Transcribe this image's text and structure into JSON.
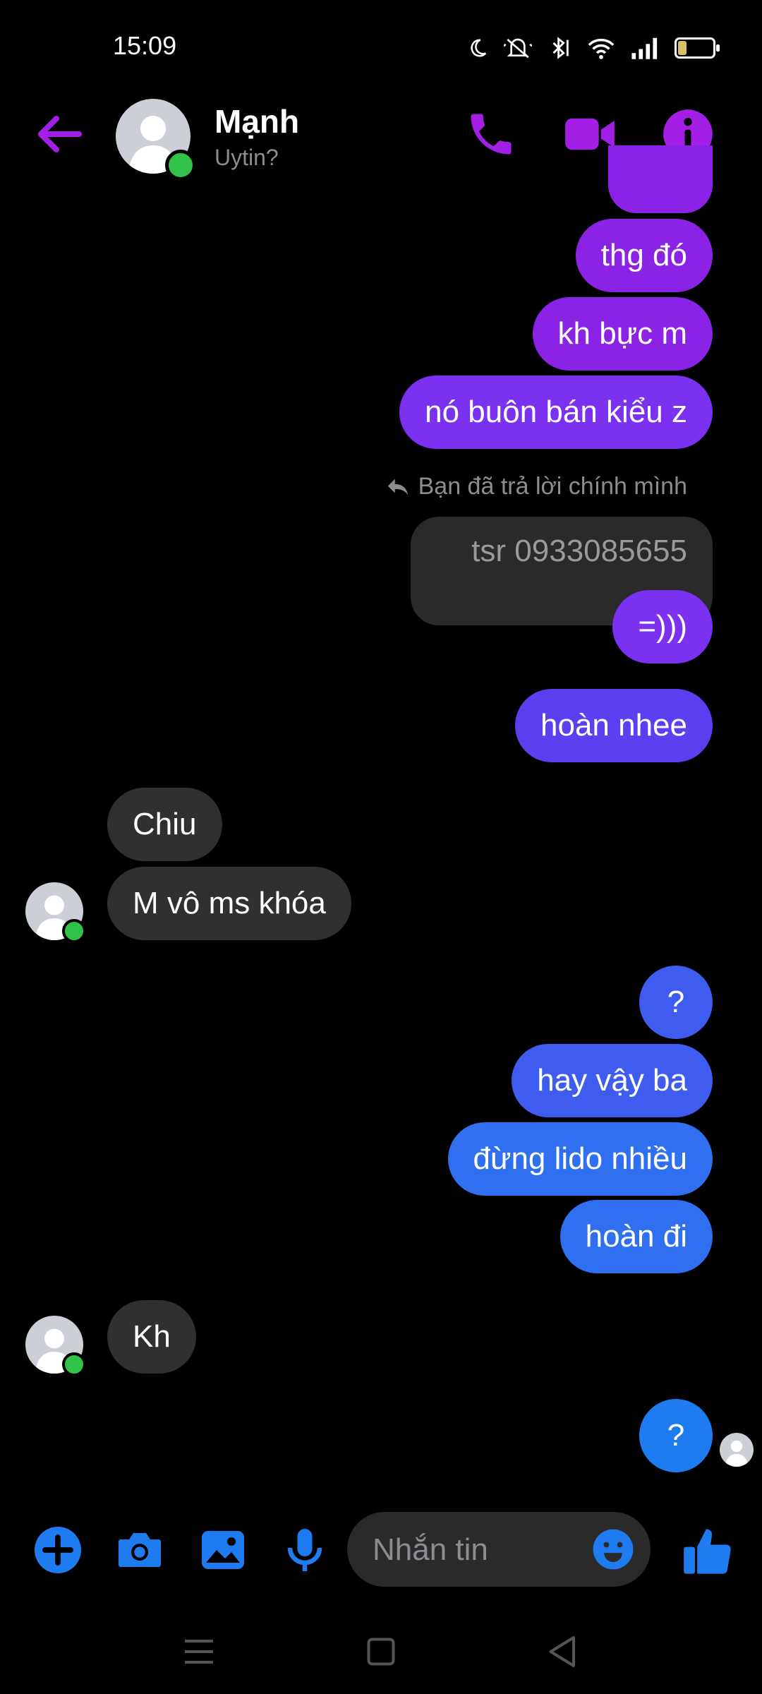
{
  "status_bar": {
    "time": "15:09",
    "battery": "26",
    "battery_level": 0.26
  },
  "header": {
    "name": "Mạnh",
    "subtitle": "Uytin?"
  },
  "messages": {
    "out_1": "thg đó",
    "out_2": "kh bực m",
    "out_3": "nó buôn bán kiểu z",
    "reply_hint": "Bạn đã trả lời chính mình",
    "quoted": "tsr 0933085655",
    "out_4": "=)))",
    "out_5": "hoàn nhee",
    "in_1": "Chiu",
    "in_2": "M vô ms khóa",
    "out_6": "?",
    "out_7": "hay vậy ba",
    "out_8": "đừng lido nhiều",
    "out_9": "hoàn đi",
    "in_3": "Kh",
    "out_10": "?"
  },
  "composer": {
    "placeholder": "Nhắn tin"
  },
  "colors": {
    "accent": "#a31fe6",
    "blue": "#1e7cf0",
    "online": "#31c24a"
  },
  "icons": [
    "back-arrow-icon",
    "phone-icon",
    "video-icon",
    "info-icon",
    "plus-icon",
    "camera-icon",
    "gallery-icon",
    "mic-icon",
    "emoji-icon",
    "like-icon",
    "menu-icon",
    "home-icon",
    "back-icon"
  ]
}
